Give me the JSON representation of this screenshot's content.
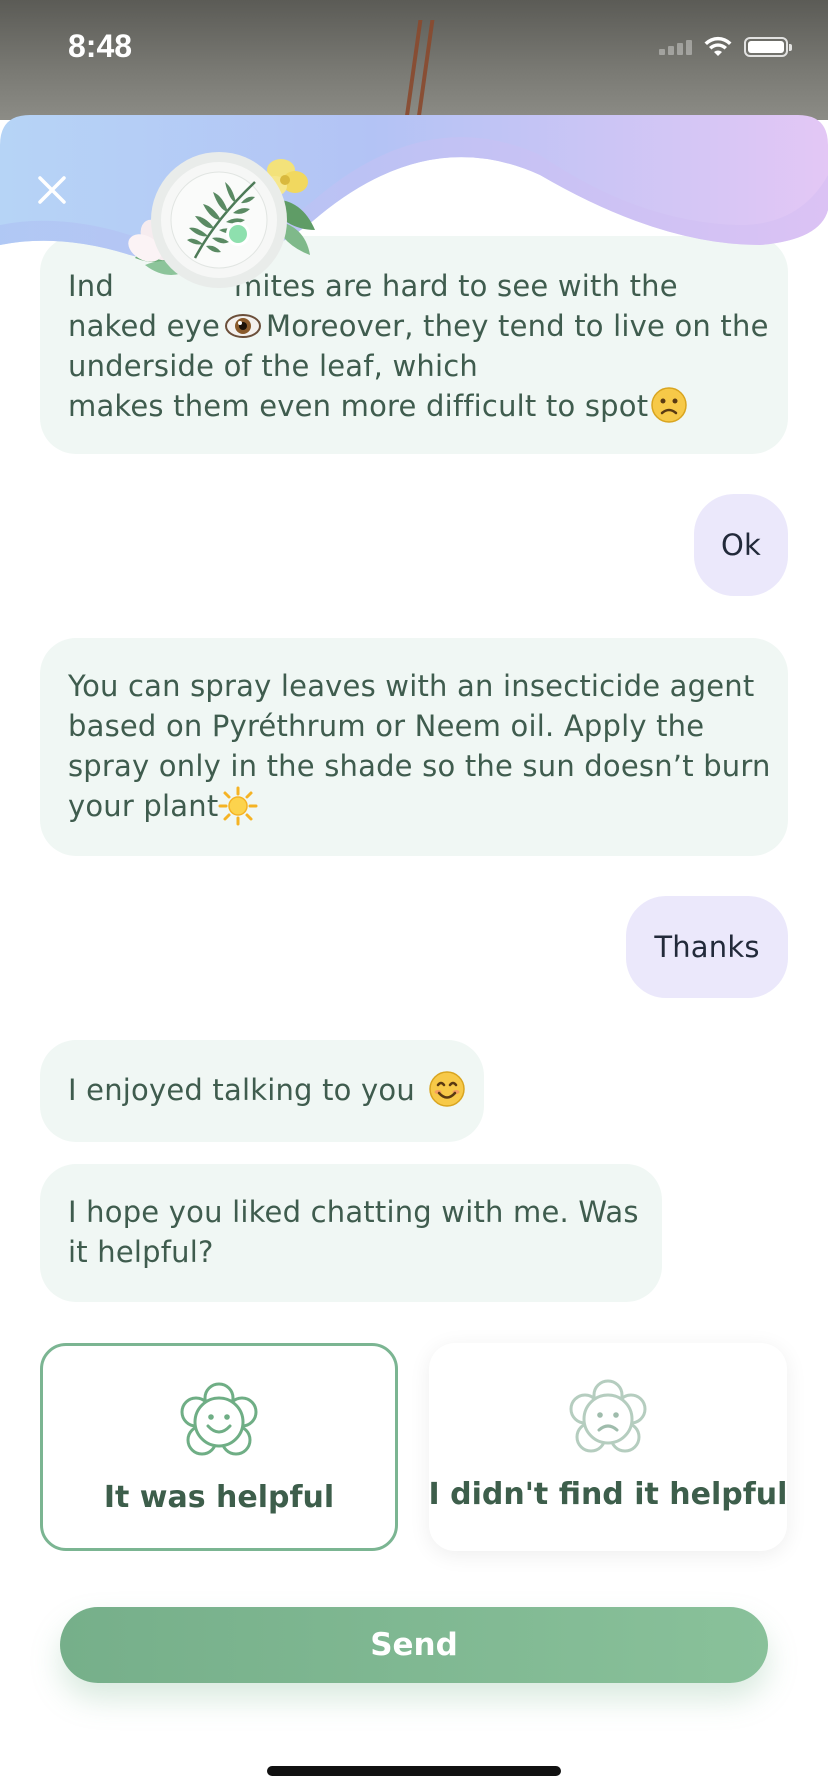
{
  "status": {
    "time": "8:48"
  },
  "messages": [
    {
      "from": "bot",
      "lines": [
        "Ind",
        "mites are hard to see with the",
        "naked eye",
        "Moreover, they tend to live on the",
        "underside of the leaf, which",
        "makes them even more difficult to spot"
      ],
      "emoji": [
        "eye-emoji",
        "frown-emoji"
      ]
    },
    {
      "from": "user",
      "text": "Ok"
    },
    {
      "from": "bot",
      "lines": [
        "You can spray leaves with an insecticide agent",
        "based on Pyréthrum or Neem oil. Apply the",
        "spray only in the shade so the sun doesn’t burn",
        "your plant"
      ],
      "emoji": [
        "sun-emoji"
      ]
    },
    {
      "from": "user",
      "text": "Thanks"
    },
    {
      "from": "bot",
      "lines": [
        "I enjoyed talking to you"
      ],
      "emoji": [
        "smile-emoji"
      ]
    },
    {
      "from": "bot",
      "lines": [
        "I hope you liked chatting with me. Was",
        "it helpful?"
      ]
    }
  ],
  "feedback": {
    "options": [
      {
        "label": "It was helpful",
        "icon": "happy-flower-icon",
        "selected": true
      },
      {
        "label": "I didn't find it helpful",
        "icon": "sad-flower-icon",
        "selected": false
      }
    ]
  },
  "send_label": "Send",
  "colors": {
    "accent": "#7bb592",
    "bot_bubble": "#f0f7f4",
    "user_bubble": "#ebe8fb",
    "text": "#3f5c4e"
  }
}
